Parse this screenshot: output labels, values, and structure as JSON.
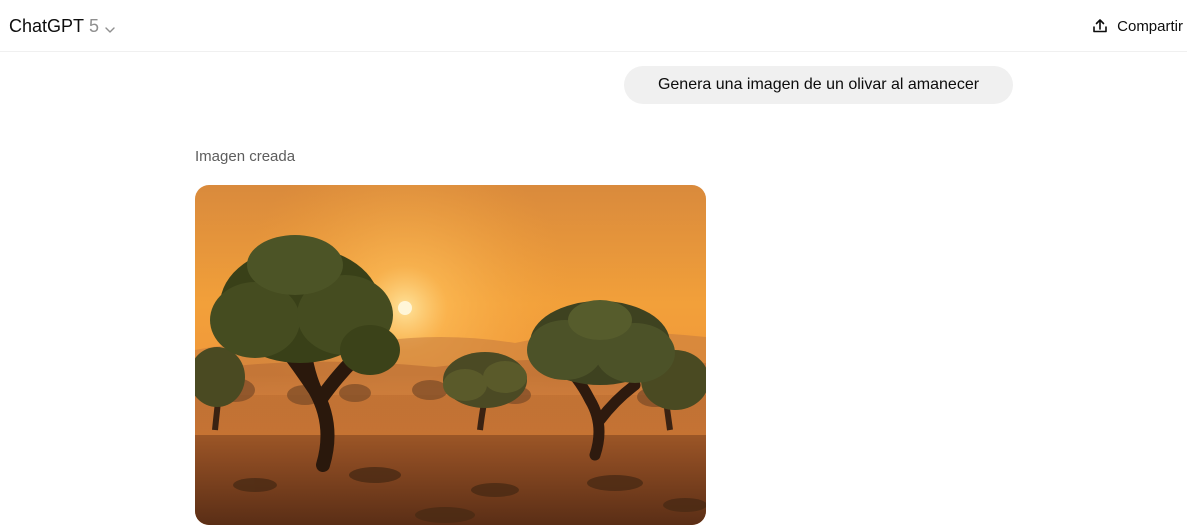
{
  "header": {
    "model_name": "ChatGPT",
    "model_version": "5",
    "share_label": "Compartir"
  },
  "conversation": {
    "user_message": "Genera una imagen de un olivar al amanecer",
    "assistant_status": "Imagen creada"
  },
  "icons": {
    "model_dropdown": "chevron-down-icon",
    "share": "share-upload-icon"
  }
}
